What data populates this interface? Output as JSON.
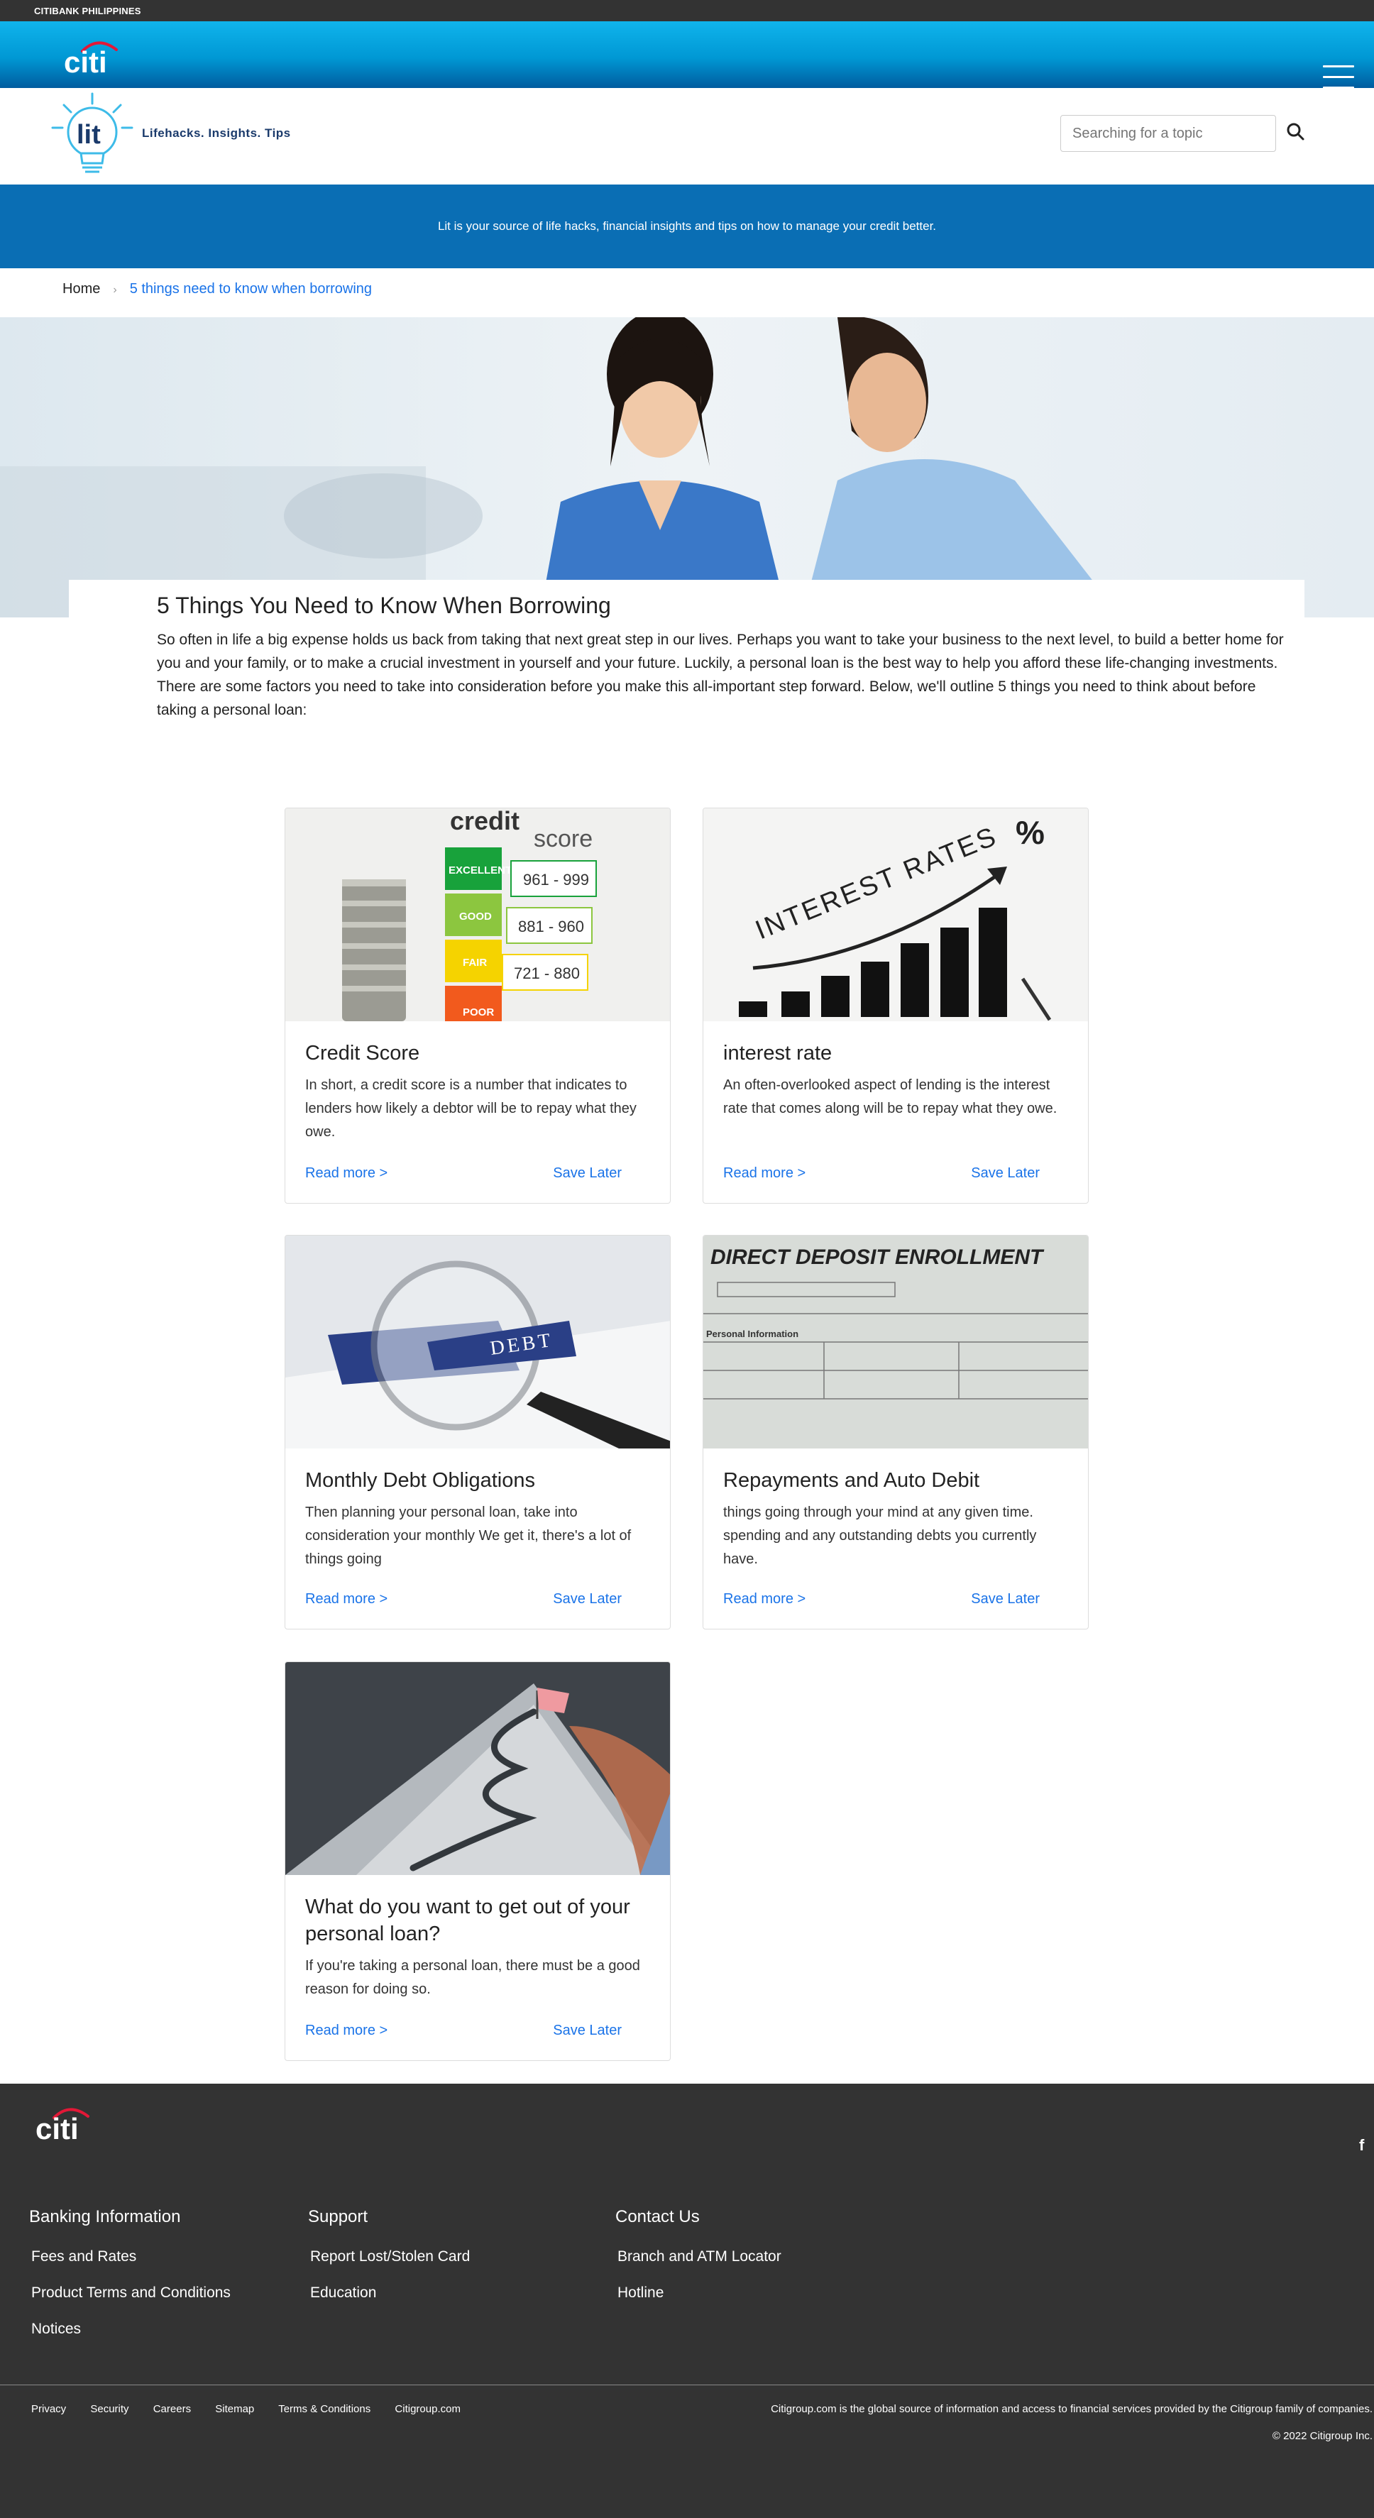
{
  "topbar": {
    "label": "CITIBANK PHILIPPINES"
  },
  "brand": {
    "logo_text": "citi",
    "accent": "#e31837",
    "bar_color": "#0a9ee0"
  },
  "lit": {
    "logo_text": "lit",
    "tagline": "Lifehacks. Insights. Tips"
  },
  "search": {
    "placeholder": "Searching for a topic"
  },
  "banner": {
    "text": "Lit is your source of life hacks, financial insights and tips on how to manage your credit better."
  },
  "breadcrumb": {
    "home": "Home",
    "current": "5 things need to know when borrowing"
  },
  "article": {
    "title": "5 Things You Need to Know When Borrowing",
    "body": "So often in life a big expense holds us back from taking that next great step in our lives. Perhaps you want to take your business to the next level, to build a better home for you and your family, or to make a crucial investment in yourself and your future. Luckily, a personal loan is the best way to help you afford these life-changing investments. There are some factors you need to take into consideration before you make this all-important step forward. Below, we'll outline 5 things you need to think about before taking a personal loan:"
  },
  "cards": [
    {
      "title": "Credit Score",
      "text": "In short, a credit score is a number that indicates to lenders how likely a debtor will be to repay what they owe.",
      "read": "Read more >",
      "save": "Save Later",
      "img": {
        "heading1": "credit",
        "heading2": "score",
        "tiers": [
          "EXCELLENT",
          "GOOD",
          "FAIR",
          "POOR"
        ],
        "ranges": [
          "961 - 999",
          "881 - 960",
          "721 - 880"
        ]
      }
    },
    {
      "title": "interest rate",
      "text": "An often-overlooked aspect of lending is the interest rate that comes along will be to repay what they owe.",
      "read": "Read more >",
      "save": "Save Later",
      "img": {
        "heading": "INTEREST RATES",
        "symbol": "%"
      }
    },
    {
      "title": "Monthly Debt Obligations",
      "text": "Then planning your personal loan, take into consideration your monthly We get it, there's a lot of things going",
      "read": "Read more >",
      "save": "Save Later",
      "img": {
        "word": "DEBT"
      }
    },
    {
      "title": "Repayments and Auto Debit",
      "text": "things going through your mind at any given time. spending and any outstanding debts you currently have.",
      "read": "Read more >",
      "save": "Save Later",
      "img": {
        "heading": "DIRECT DEPOSIT ENROLLMENT",
        "section": "Personal Information"
      }
    },
    {
      "title": "What do you want to get out of your personal loan?",
      "text": "If you're taking a personal loan, there must be a good reason for doing so.",
      "read": "Read more >",
      "save": "Save Later",
      "img": {}
    }
  ],
  "footer": {
    "logo_text": "citi",
    "social": "f",
    "columns": [
      {
        "heading": "Banking Information",
        "links": [
          "Fees and Rates",
          "Product Terms and Conditions",
          "Notices"
        ]
      },
      {
        "heading": "Support",
        "links": [
          "Report Lost/Stolen Card",
          "Education"
        ]
      },
      {
        "heading": "Contact Us",
        "links": [
          "Branch and ATM Locator",
          "Hotline"
        ]
      }
    ],
    "bottom_links": [
      "Privacy",
      "Security",
      "Careers",
      "Sitemap",
      "Terms & Conditions",
      "Citigroup.com"
    ],
    "note": "Citigroup.com is the global source of information and access to financial services provided by the Citigroup family of companies.",
    "copyright": "© 2022 Citigroup Inc."
  }
}
